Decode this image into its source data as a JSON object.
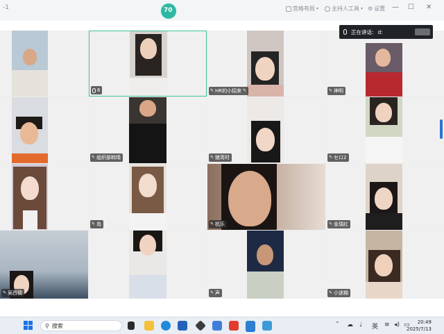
{
  "titlebar": {
    "left_text": "-1",
    "logo_text": "70",
    "buttons": [
      "宫格布局",
      "主持人工具",
      "设置"
    ],
    "win_controls": [
      "—",
      "☐",
      "✕"
    ]
  },
  "speaking": {
    "label": "正在讲话:",
    "name": "d:"
  },
  "tiles": [
    {
      "name": ""
    },
    {
      "name": "6"
    },
    {
      "name": "HR的小招来"
    },
    {
      "name": "神明"
    },
    {
      "name": ""
    },
    {
      "name": "组织部韩晴"
    },
    {
      "name": "猪青时"
    },
    {
      "name": "セロ2"
    },
    {
      "name": ""
    },
    {
      "name": "岛"
    },
    {
      "name": "杭乐"
    },
    {
      "name": "金瑞红"
    },
    {
      "name": "吴西德"
    },
    {
      "name": ""
    },
    {
      "name": "声"
    },
    {
      "name": "小迷糊"
    }
  ],
  "taskbar": {
    "search_placeholder": "搜索",
    "lang": "英",
    "time": "20:49",
    "date": "2025/7/13"
  }
}
